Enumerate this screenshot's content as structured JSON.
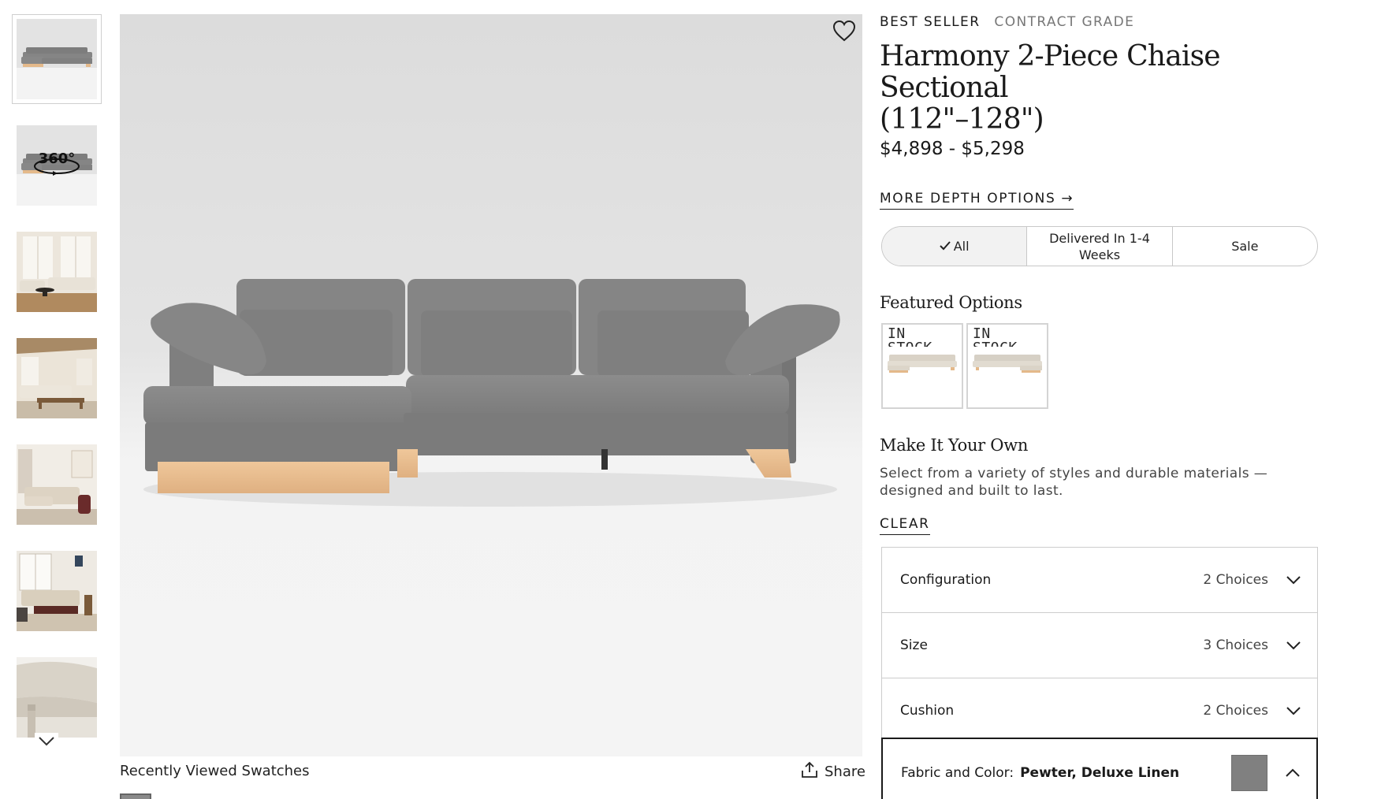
{
  "gallery": {
    "thumbnails": [
      {
        "name": "thumb-sofa-gray",
        "active": true
      },
      {
        "name": "thumb-360",
        "label": "360°"
      },
      {
        "name": "thumb-room-1"
      },
      {
        "name": "thumb-room-2"
      },
      {
        "name": "thumb-room-3"
      },
      {
        "name": "thumb-room-4"
      },
      {
        "name": "thumb-detail"
      }
    ],
    "next_icon": "chevron-down-icon"
  },
  "hero": {
    "favorite_icon": "heart-icon",
    "sofa_color": "#8a8a8a",
    "leg_color": "#e4b98a"
  },
  "below_image": {
    "recently_viewed_label": "Recently Viewed Swatches",
    "share_label": "Share",
    "share_icon": "share-icon"
  },
  "product": {
    "badge_primary": "BEST SELLER",
    "badge_secondary": "CONTRACT GRADE",
    "title_line1": "Harmony 2-Piece Chaise Sectional",
    "title_line2": "(112\"–128\")",
    "price": "$4,898 - $5,298",
    "more_depth_label": "MORE DEPTH OPTIONS",
    "more_depth_arrow": "→"
  },
  "filters": [
    {
      "label": "All",
      "selected": true
    },
    {
      "label": "Delivered In 1-4 Weeks",
      "line1": "Delivered In 1-4",
      "line2": "Weeks"
    },
    {
      "label": "Sale"
    }
  ],
  "featured": {
    "heading": "Featured Options",
    "items": [
      {
        "tag_line1": "IN",
        "tag_line2": "STOCK"
      },
      {
        "tag_line1": "IN",
        "tag_line2": "STOCK"
      }
    ]
  },
  "make_it_your_own": {
    "heading": "Make It Your Own",
    "description": "Select from a variety of styles and durable materials — designed and built to last.",
    "clear_label": "CLEAR"
  },
  "options": [
    {
      "label": "Configuration",
      "count": "2 Choices",
      "open": false
    },
    {
      "label": "Size",
      "count": "3 Choices",
      "open": false
    },
    {
      "label": "Cushion",
      "count": "2 Choices",
      "open": false
    },
    {
      "label": "Fabric and Color:",
      "value": "Pewter, Deluxe Linen",
      "open": true,
      "swatch_color": "#808080"
    }
  ],
  "colors": {
    "text": "#1a1a1a",
    "muted": "#777777",
    "border": "#cccccc"
  }
}
